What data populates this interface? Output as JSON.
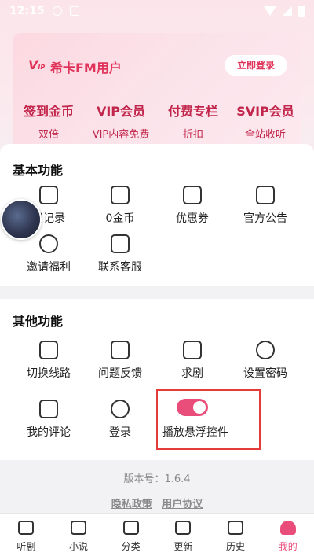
{
  "status": {
    "time": "12:15"
  },
  "vip": {
    "logo": "V",
    "logo_sub": "IP",
    "name": "希卡FM用户",
    "login_label": "立即登录",
    "perks": [
      {
        "title": "签到金币",
        "sub": "双倍"
      },
      {
        "title": "VIP会员",
        "sub": "VIP内容免费"
      },
      {
        "title": "付费专栏",
        "sub": "折扣"
      },
      {
        "title": "SVIP会员",
        "sub": "全站收听"
      }
    ]
  },
  "basic": {
    "title": "基本功能",
    "items": [
      {
        "label": "费记录",
        "icon": "clipboard-icon"
      },
      {
        "label": "0金币",
        "icon": "wallet-icon"
      },
      {
        "label": "优惠券",
        "icon": "coupon-icon"
      },
      {
        "label": "官方公告",
        "icon": "speaker-icon"
      },
      {
        "label": "邀请福利",
        "icon": "heart-handshake-icon"
      },
      {
        "label": "联系客服",
        "icon": "service-icon"
      }
    ]
  },
  "other": {
    "title": "其他功能",
    "items": [
      {
        "label": "切换线路",
        "icon": "switch-route-icon"
      },
      {
        "label": "问题反馈",
        "icon": "feedback-icon"
      },
      {
        "label": "求剧",
        "icon": "request-icon"
      },
      {
        "label": "设置密码",
        "icon": "gear-icon"
      },
      {
        "label": "我的评论",
        "icon": "comment-icon"
      },
      {
        "label": "登录",
        "icon": "power-icon"
      }
    ],
    "toggle": {
      "label": "播放悬浮控件",
      "on": true
    }
  },
  "footer": {
    "version": "版本号：1.6.4",
    "privacy": "隐私政策",
    "agreement": "用户协议"
  },
  "nav": [
    {
      "label": "听剧",
      "icon": "radio-icon"
    },
    {
      "label": "小说",
      "icon": "book-icon"
    },
    {
      "label": "分类",
      "icon": "category-icon"
    },
    {
      "label": "更新",
      "icon": "update-icon"
    },
    {
      "label": "历史",
      "icon": "history-icon"
    },
    {
      "label": "我的",
      "icon": "profile-icon"
    }
  ],
  "colors": {
    "accent": "#e94e7b",
    "vip_text": "#c2254b",
    "highlight_border": "#e53b3b"
  }
}
